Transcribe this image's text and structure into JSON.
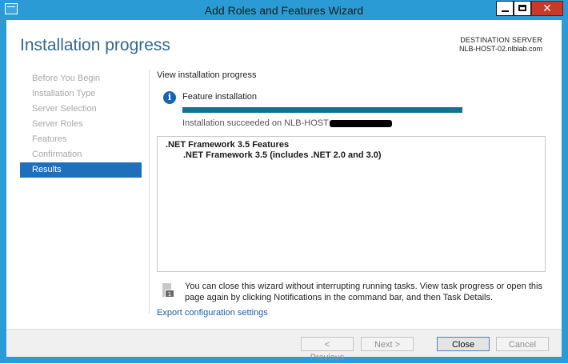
{
  "window": {
    "title": "Add Roles and Features Wizard",
    "close_glyph": "✕",
    "accent_color": "#2b9bd6"
  },
  "header": {
    "page_title": "Installation progress",
    "destination_label": "DESTINATION SERVER",
    "destination_server": "NLB-HOST-02.nlblab.com"
  },
  "nav": {
    "items": [
      {
        "label": "Before You Begin"
      },
      {
        "label": "Installation Type"
      },
      {
        "label": "Server Selection"
      },
      {
        "label": "Server Roles"
      },
      {
        "label": "Features"
      },
      {
        "label": "Confirmation"
      },
      {
        "label": "Results"
      }
    ],
    "selected": "Results"
  },
  "main": {
    "section_title": "View installation progress",
    "info_glyph": "i",
    "feature_installation_label": "Feature installation",
    "progress_fraction": 1.0,
    "status_text": "Installation succeeded on NLB-HOST",
    "results": {
      "parent": ".NET Framework 3.5 Features",
      "child": ".NET Framework 3.5 (includes .NET 2.0 and 3.0)"
    },
    "note_badge": "1",
    "note_text": "You can close this wizard without interrupting running tasks. View task progress or open this page again by clicking Notifications in the command bar, and then Task Details.",
    "export_link": "Export configuration settings"
  },
  "footer": {
    "previous_label": "< Previous",
    "next_label": "Next >",
    "close_label": "Close",
    "cancel_label": "Cancel"
  }
}
